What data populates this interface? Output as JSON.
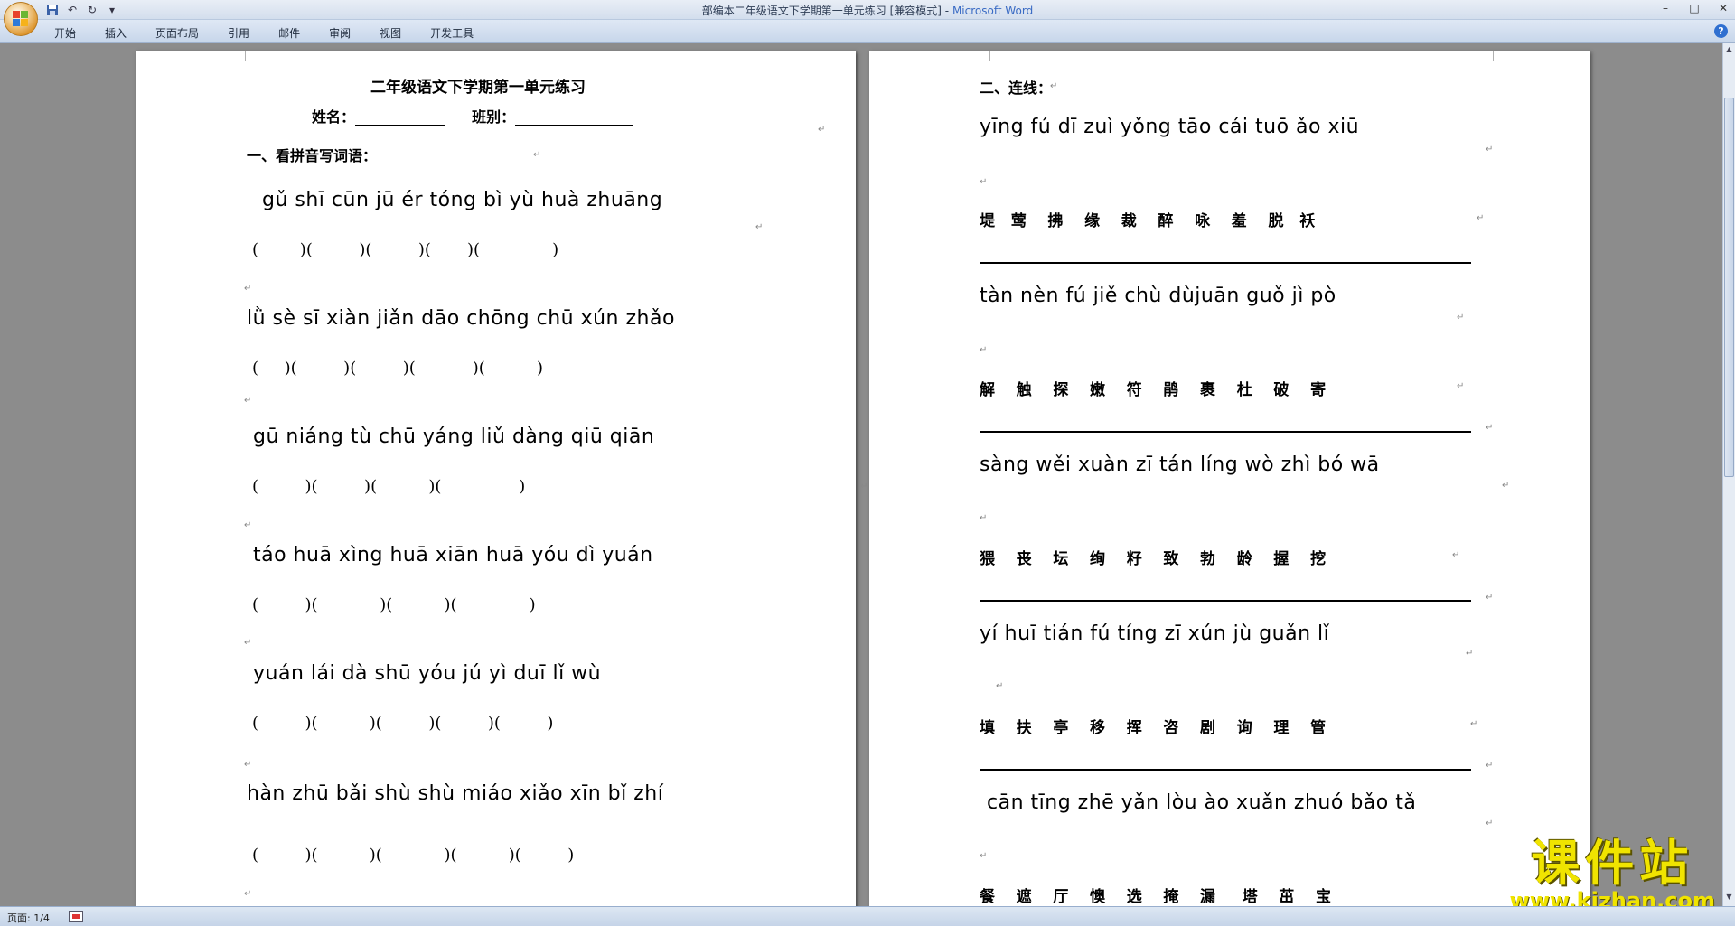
{
  "window": {
    "title": "部编本二年级语文下学期第一单元练习 [兼容模式]",
    "app_name": "Microsoft Word",
    "separator": " - "
  },
  "ribbon": {
    "tabs": [
      "开始",
      "插入",
      "页面布局",
      "引用",
      "邮件",
      "审阅",
      "视图",
      "开发工具"
    ]
  },
  "page1": {
    "title": "二年级语文下学期第一单元练习",
    "name_label": "姓名：",
    "class_label": "班别：",
    "section_heading": "一、看拼音写词语：",
    "rows": [
      {
        "pinyin": "gǔ shī  cūn jū  ér tóng  bì yù  huà zhuāng",
        "brackets": "(        )(         )(         )(       )(              )"
      },
      {
        "pinyin": "lǜ sè  sī xiàn jiǎn dāo chōng chū  xún zhǎo",
        "brackets": "(     )(         )(         )(           )(          )"
      },
      {
        "pinyin": "gū niáng  tù chū  yáng liǔ  dàng qiū qiān",
        "brackets": "(         )(         )(          )(               )"
      },
      {
        "pinyin": "táo huā   xìng huā   xiān huā   yóu dì  yuán",
        "brackets": "(         )(            )(          )(              )"
      },
      {
        "pinyin": "yuán lái   dà shū   yóu jú   yì duī   lǐ wù",
        "brackets": "(         )(          )(         )(         )(         )"
      },
      {
        "pinyin": "hàn zhū  bǎi shù  shù miáo  xiǎo xīn bǐ  zhí",
        "brackets": "(         )(          )(            )(          )(         )"
      }
    ]
  },
  "page2": {
    "section_heading": "二、连线：",
    "groups": [
      {
        "pinyin": "yīng fú  dī  zuì  yǒng  tāo  cái  tuō  ǎo  xiū",
        "chars": "堤   莺    拂    缘    裁    醉    咏    羞    脱   袄"
      },
      {
        "pinyin": "tàn  nèn  fú  jiě  chù  dùjuān  guǒ  jì  pò",
        "chars": "解    触    探    嫩    符    鹃    裹    杜    破    寄"
      },
      {
        "pinyin": "sàng  wěi  xuàn  zī  tán líng  wò  zhì  bó  wā",
        "chars": "猥    丧    坛    绚    籽    致    勃    龄    握    挖"
      },
      {
        "pinyin": "yí  huī  tián  fú  tíng  zī xún  jù  guǎn lǐ",
        "chars": "填    扶    亭    移    挥    咨    剧    询    理    管"
      },
      {
        "pinyin": "cān tīng  zhē  yǎn lòu  ào xuǎn  zhuó bǎo tǎ",
        "chars": "餐    遮    厅    懊    选    掩    漏     塔    茁    宝"
      }
    ]
  },
  "statusbar": {
    "page_count": "页面: 1/4"
  },
  "watermark": {
    "cn": "课件站",
    "url": "www.kjzhan.com"
  },
  "icons": [
    "office-logo-icon",
    "save-icon",
    "undo-icon",
    "redo-icon",
    "qat-dropdown-icon",
    "minimize-icon",
    "maximize-icon",
    "close-icon",
    "help-icon",
    "proofing-icon"
  ]
}
